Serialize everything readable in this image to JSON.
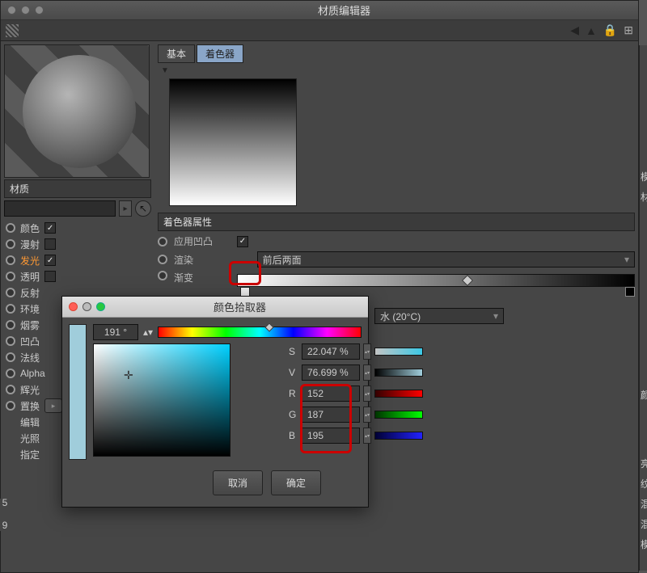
{
  "window": {
    "title": "材质编辑器"
  },
  "leftPanel": {
    "materialLabel": "材质",
    "props": [
      {
        "label": "颜色",
        "checked": true
      },
      {
        "label": "漫射",
        "checked": false
      },
      {
        "label": "发光",
        "checked": true
      },
      {
        "label": "透明",
        "checked": false
      },
      {
        "label": "反射",
        "checked": false
      },
      {
        "label": "环境",
        "checked": false
      },
      {
        "label": "烟雾",
        "checked": false
      },
      {
        "label": "凹凸",
        "checked": false
      },
      {
        "label": "法线",
        "checked": false
      },
      {
        "label": "Alpha",
        "checked": false
      },
      {
        "label": "辉光",
        "checked": false
      },
      {
        "label": "置换",
        "checked": false
      }
    ],
    "extraLabels": [
      "编辑",
      "光照",
      "指定"
    ]
  },
  "tabs": {
    "basic": "基本",
    "shader": "着色器"
  },
  "shaderProps": {
    "heading": "着色器属性",
    "bump": {
      "label": "应用凹凸",
      "checked": true
    },
    "render": {
      "label": "渲染",
      "value": "前后两面"
    },
    "gradient": {
      "label": "渐变"
    }
  },
  "rightHint": {
    "select": "水 (20°C)"
  },
  "picker": {
    "title": "颜色拾取器",
    "hue": "191 °",
    "S": {
      "label": "S",
      "value": "22.047 %"
    },
    "V": {
      "label": "V",
      "value": "76.699 %"
    },
    "R": {
      "label": "R",
      "value": "152"
    },
    "G": {
      "label": "G",
      "value": "187"
    },
    "B": {
      "label": "B",
      "value": "195"
    },
    "cancel": "取消",
    "ok": "确定"
  },
  "rightStrip": [
    "模",
    "材",
    "颜",
    "亮",
    "纹",
    "混",
    "混",
    "模"
  ],
  "bottom": {
    "five": "5",
    "nine": "9"
  },
  "colors": {
    "swatch": "#a0cddb",
    "S_slider": "linear-gradient(90deg,#c4c4c4,#00bcd4)",
    "V_slider": "linear-gradient(90deg,#000,#a0cddb)",
    "R_slider": "linear-gradient(90deg,#300,#f00)",
    "G_slider": "linear-gradient(90deg,#030,#0f0)",
    "B_slider": "linear-gradient(90deg,#003,#00f)"
  }
}
